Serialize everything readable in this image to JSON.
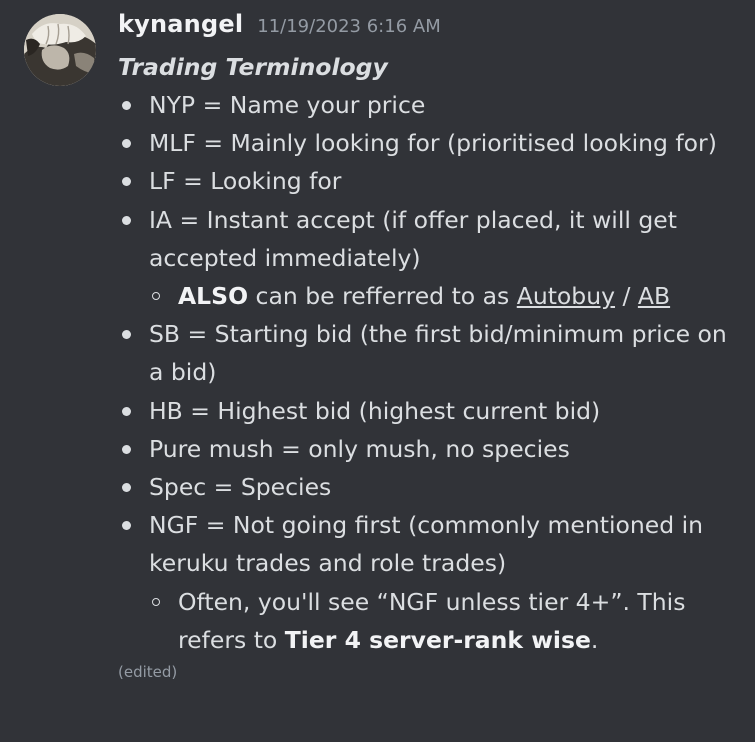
{
  "message": {
    "username": "kynangel",
    "timestamp": "11/19/2023 6:16 AM",
    "title": "Trading Terminology",
    "edited": "(edited)",
    "terms": [
      "NYP = Name your price",
      "MLF = Mainly looking for (prioritised looking for)",
      "LF = Looking for",
      "IA = Instant accept (if offer placed, it will get accepted immediately)",
      "SB = Starting bid (the first bid/minimum price on a bid)",
      "HB = Highest bid (highest current bid)",
      "Pure mush = only mush, no species",
      "Spec = Species",
      "NGF = Not going first (commonly mentioned in keruku trades and role trades)"
    ],
    "ia_sub": {
      "strong": "ALSO",
      "text_mid": " can be refferred to as ",
      "link1": "Autobuy",
      "sep": " / ",
      "link2": "AB"
    },
    "ngf_sub": {
      "text": "Often, you'll see “NGF unless tier 4+”. This refers to ",
      "strong": "Tier 4 server-rank wise",
      "end": "."
    }
  },
  "colors": {
    "background": "#313338",
    "text": "#dbdee1",
    "username": "#f2f3f5",
    "muted": "#949ba4"
  },
  "icons": {
    "avatar": "user-avatar-image"
  }
}
